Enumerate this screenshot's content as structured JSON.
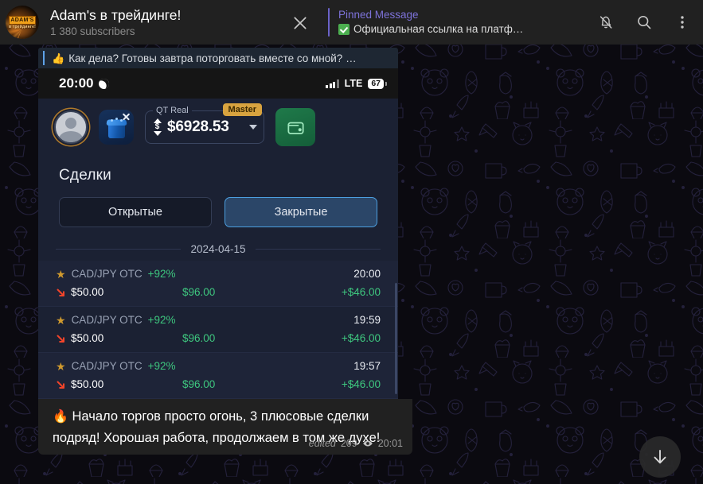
{
  "header": {
    "channel_title": "Adam's в трейдинге!",
    "subscribers": "1 380 subscribers",
    "close_icon": "close-icon",
    "pinned_label": "Pinned Message",
    "pinned_text": "Официальная ссылка на платф…",
    "pinned_emoji": "white-check-mark",
    "icons": [
      {
        "name": "notifications-muted-icon",
        "label": "Mute"
      },
      {
        "name": "search-icon",
        "label": "Search"
      },
      {
        "name": "more-menu-icon",
        "label": "More"
      }
    ]
  },
  "reply_quote": {
    "emoji": "👍",
    "text": "Как дела? Готовы завтра поторговать вместе со мной? …"
  },
  "screenshot": {
    "status_bar": {
      "time": "20:00",
      "moon_icon": "crescent-moon-icon",
      "signal_icon": "signal-bars-icon",
      "network": "LTE",
      "battery": "67"
    },
    "account_bar": {
      "avatar_name": "user-avatar",
      "gift_icon": "gift-box-icon",
      "gift_close": "close-icon",
      "balance_label": "QT Real",
      "balance_badge": "Master",
      "balance_amount": "$6928.53",
      "currency_icon": "dollar-switch-icon",
      "dropdown_icon": "chevron-down-icon",
      "wallet_icon": "wallet-icon"
    },
    "deals": {
      "title": "Сделки",
      "tabs": [
        {
          "label": "Открытые",
          "active": false
        },
        {
          "label": "Закрытые",
          "active": true
        }
      ],
      "date": "2024-04-15",
      "columns": [
        "pair",
        "payout",
        "time",
        "amount",
        "paid",
        "profit"
      ],
      "rows": [
        {
          "star": "★",
          "pair": "CAD/JPY OTC",
          "payout": "+92%",
          "time": "20:00",
          "direction": "down",
          "amount": "$50.00",
          "paid": "$96.00",
          "profit": "+$46.00"
        },
        {
          "star": "★",
          "pair": "CAD/JPY OTC",
          "payout": "+92%",
          "time": "19:59",
          "direction": "down",
          "amount": "$50.00",
          "paid": "$96.00",
          "profit": "+$46.00"
        },
        {
          "star": "★",
          "pair": "CAD/JPY OTC",
          "payout": "+92%",
          "time": "19:57",
          "direction": "down",
          "amount": "$50.00",
          "paid": "$96.00",
          "profit": "+$46.00"
        }
      ]
    }
  },
  "message": {
    "emoji": "🔥",
    "text": "Начало торгов просто огонь, 3 плюсовые сделки подряд! Хорошая работа, продолжаем в том же духе!",
    "edited": "edited",
    "views": "209",
    "views_icon": "eye-icon",
    "time": "20:01"
  },
  "scroll_button": {
    "icon": "arrow-down-icon"
  },
  "colors": {
    "accent_blue": "#4c9fe0",
    "pinned_purple": "#7d72d9",
    "profit_green": "#3ec77f",
    "badge_gold": "#d8a33f",
    "header_bg": "#212121",
    "app_bg": "#1b2133"
  }
}
